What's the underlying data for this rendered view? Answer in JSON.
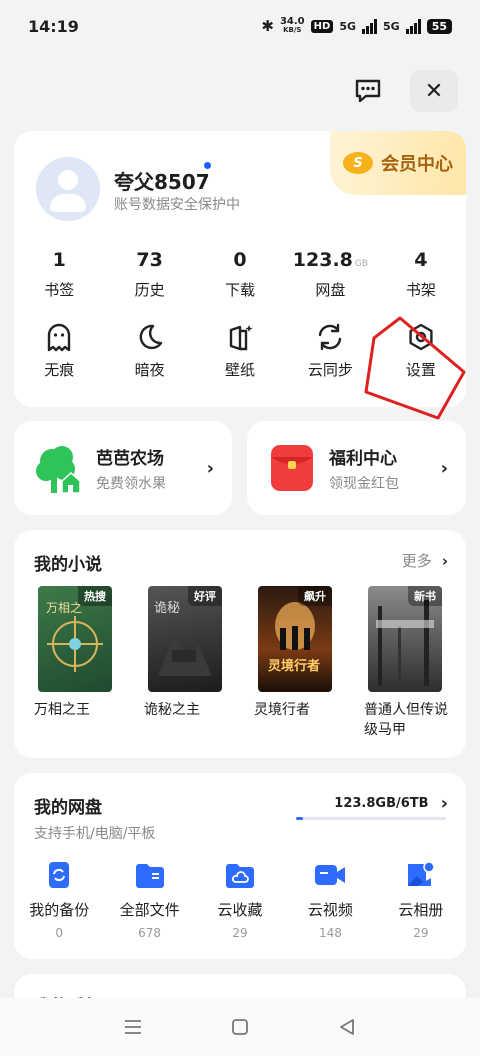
{
  "status_bar": {
    "time": "14:19",
    "net_speed": "34.0",
    "net_unit": "KB/S",
    "hd": "HD",
    "sig1": "5G",
    "sig2": "5G",
    "battery": "55"
  },
  "profile": {
    "name": "夸父8507",
    "subtitle": "账号数据安全保护中",
    "vip_label": "会员中心",
    "vip_logo": "S"
  },
  "stats": [
    {
      "value": "1",
      "unit": "",
      "label": "书签"
    },
    {
      "value": "73",
      "unit": "",
      "label": "历史"
    },
    {
      "value": "0",
      "unit": "",
      "label": "下载"
    },
    {
      "value": "123.8",
      "unit": "GB",
      "label": "网盘"
    },
    {
      "value": "4",
      "unit": "",
      "label": "书架"
    }
  ],
  "tools": [
    {
      "label": "无痕",
      "icon": "ghost-icon"
    },
    {
      "label": "暗夜",
      "icon": "moon-icon"
    },
    {
      "label": "壁纸",
      "icon": "wallpaper-icon"
    },
    {
      "label": "云同步",
      "icon": "sync-icon"
    },
    {
      "label": "设置",
      "icon": "settings-icon"
    }
  ],
  "promos": {
    "farm": {
      "title": "芭芭农场",
      "subtitle": "免费领水果"
    },
    "welfare": {
      "title": "福利中心",
      "subtitle": "领现金红包"
    }
  },
  "novels": {
    "title": "我的小说",
    "more": "更多",
    "books": [
      {
        "title": "万相之王",
        "tag": "热搜"
      },
      {
        "title": "诡秘之主",
        "tag": "好评"
      },
      {
        "title": "灵境行者",
        "tag": "飙升"
      },
      {
        "title": "普通人但传说级马甲",
        "tag": "新书"
      }
    ]
  },
  "disk": {
    "title": "我的网盘",
    "subtitle": "支持手机/电脑/平板",
    "usage": "123.8GB/6TB",
    "usage_fraction": 0.02,
    "items": [
      {
        "label": "我的备份",
        "count": "0"
      },
      {
        "label": "全部文件",
        "count": "678"
      },
      {
        "label": "云收藏",
        "count": "29"
      },
      {
        "label": "云视频",
        "count": "148"
      },
      {
        "label": "云相册",
        "count": "29"
      }
    ]
  },
  "next_section": {
    "title": "我的手机"
  },
  "colors": {
    "accent": "#2e6bff",
    "vip_text": "#a5630f",
    "annotation": "#e02020"
  }
}
